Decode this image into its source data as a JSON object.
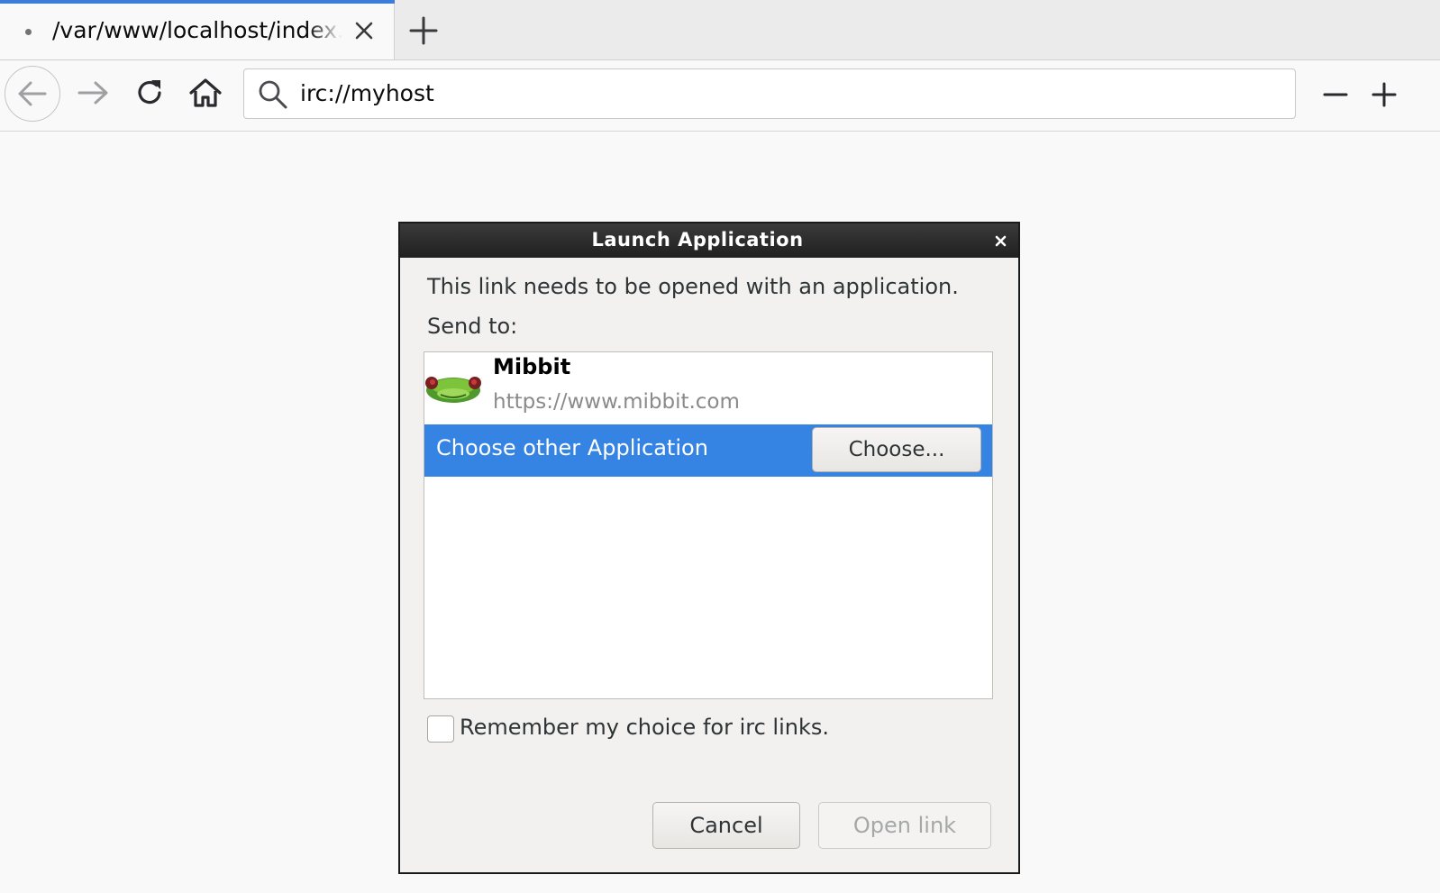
{
  "browser": {
    "tab": {
      "title": "/var/www/localhost/index.html"
    },
    "url": "irc://myhost",
    "icons": {
      "back": "back-arrow-icon",
      "forward": "forward-arrow-icon",
      "reload": "reload-icon",
      "home": "home-icon",
      "search": "search-icon",
      "zoom_out": "minus-icon",
      "zoom_in": "plus-icon",
      "new_tab": "plus-icon",
      "tab_close": "close-icon"
    }
  },
  "dialog": {
    "title": "Launch Application",
    "message": "This link needs to be opened with an application.",
    "send_to_label": "Send to:",
    "apps": [
      {
        "name": "Mibbit",
        "url": "https://www.mibbit.com",
        "icon": "mibbit-frog-icon"
      }
    ],
    "choose_other_label": "Choose other Application",
    "choose_button": "Choose...",
    "remember_label": "Remember my choice for irc links.",
    "remember_checked": false,
    "cancel_button": "Cancel",
    "open_button": "Open link",
    "open_button_enabled": false,
    "selection_color": "#3584e4"
  }
}
